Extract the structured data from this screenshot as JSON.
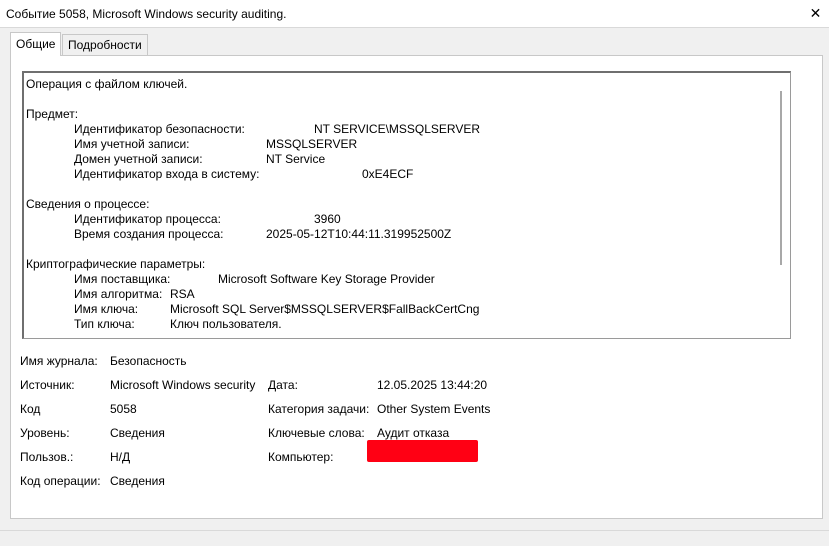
{
  "window": {
    "title": "Событие 5058, Microsoft Windows security auditing.",
    "close_glyph": "✕"
  },
  "tabs": [
    {
      "label": "Общие"
    },
    {
      "label": "Подробности"
    }
  ],
  "description": "Операция с файлом ключей.\n\nПредмет:\n\tИдентификатор безопасности:\t\tNT SERVICE\\MSSQLSERVER\n\tИмя учетной записи:\t\tMSSQLSERVER\n\tДомен учетной записи:\t\tNT Service\n\tИдентификатор входа в систему:\t\t0xE4ECF\n\nСведения о процессе:\n\tИдентификатор процесса:\t\t3960\n\tВремя создания процесса:\t2025-05-12T10:44:11.319952500Z\n\nКриптографические параметры:\n\tИмя поставщика:\tMicrosoft Software Key Storage Provider\n\tИмя алгоритма:\tRSA\n\tИмя ключа:\tMicrosoft SQL Server$MSSQLSERVER$FallBackCertCng\n\tТип ключа:\tКлюч пользователя.",
  "fields": {
    "log_name": {
      "label": "Имя журнала:",
      "value": "Безопасность"
    },
    "source": {
      "label": "Источник:",
      "value": "Microsoft Windows security"
    },
    "date": {
      "label": "Дата:",
      "value": "12.05.2025 13:44:20"
    },
    "code": {
      "label": "Код",
      "value": "5058"
    },
    "task_category": {
      "label": "Категория задачи:",
      "value": "Other System Events"
    },
    "level": {
      "label": "Уровень:",
      "value": "Сведения"
    },
    "keywords": {
      "label": "Ключевые слова:",
      "value": "Аудит отказа"
    },
    "user": {
      "label": "Пользов.:",
      "value": "Н/Д"
    },
    "computer": {
      "label": "Компьютер:",
      "value": ""
    },
    "opcode": {
      "label": "Код операции:",
      "value": "Сведения"
    }
  },
  "colors": {
    "redaction": "#ff0014"
  }
}
